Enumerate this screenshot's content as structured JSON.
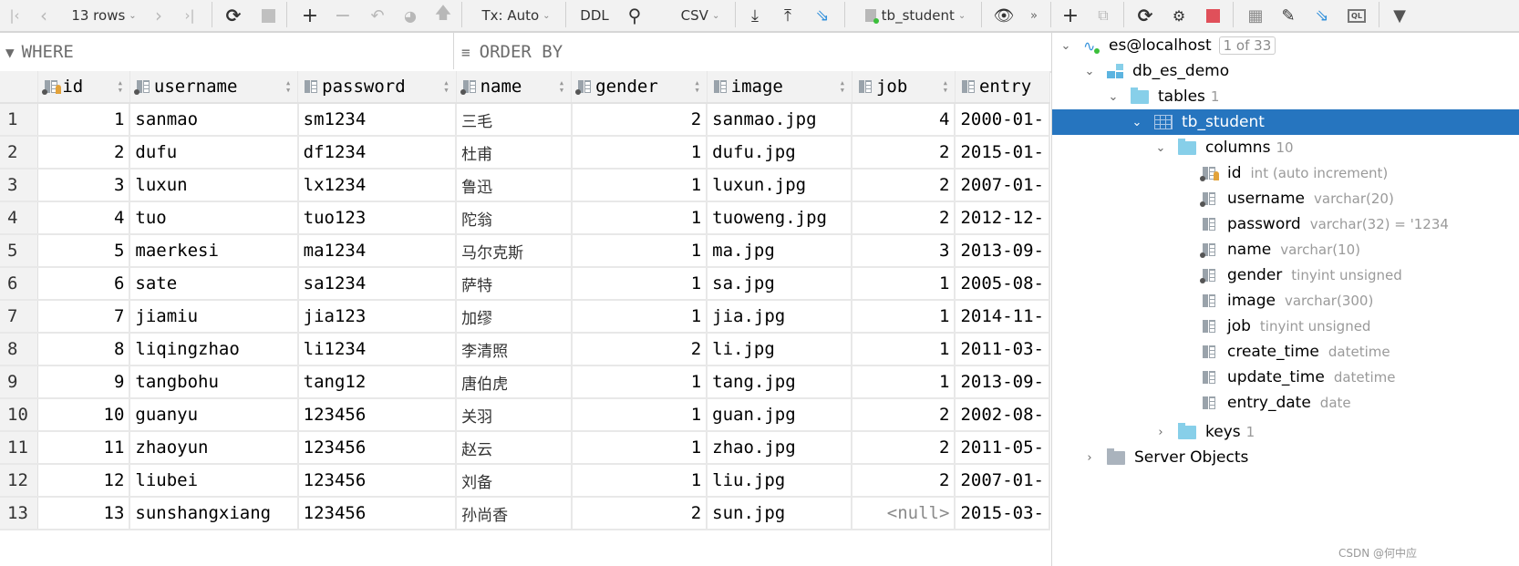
{
  "toolbar": {
    "rows_label": "13 rows",
    "tx_label": "Tx: Auto",
    "ddl_label": "DDL",
    "export_format": "CSV",
    "table_selector": "tb_student",
    "more_label": "»"
  },
  "filter": {
    "where_placeholder": "WHERE",
    "orderby_placeholder": "ORDER BY"
  },
  "grid": {
    "columns": [
      "id",
      "username",
      "password",
      "name",
      "gender",
      "image",
      "job",
      "entry"
    ],
    "rows": [
      {
        "n": "1",
        "id": "1",
        "username": "sanmao",
        "password": "sm1234",
        "name": "三毛",
        "gender": "2",
        "image": "sanmao.jpg",
        "job": "4",
        "entry": "2000-01-"
      },
      {
        "n": "2",
        "id": "2",
        "username": "dufu",
        "password": "df1234",
        "name": "杜甫",
        "gender": "1",
        "image": "dufu.jpg",
        "job": "2",
        "entry": "2015-01-"
      },
      {
        "n": "3",
        "id": "3",
        "username": "luxun",
        "password": "lx1234",
        "name": "鲁迅",
        "gender": "1",
        "image": "luxun.jpg",
        "job": "2",
        "entry": "2007-01-"
      },
      {
        "n": "4",
        "id": "4",
        "username": "tuo",
        "password": "tuo123",
        "name": "陀翁",
        "gender": "1",
        "image": "tuoweng.jpg",
        "job": "2",
        "entry": "2012-12-"
      },
      {
        "n": "5",
        "id": "5",
        "username": "maerkesi",
        "password": "ma1234",
        "name": "马尔克斯",
        "gender": "1",
        "image": "ma.jpg",
        "job": "3",
        "entry": "2013-09-"
      },
      {
        "n": "6",
        "id": "6",
        "username": "sate",
        "password": "sa1234",
        "name": "萨特",
        "gender": "1",
        "image": "sa.jpg",
        "job": "1",
        "entry": "2005-08-"
      },
      {
        "n": "7",
        "id": "7",
        "username": "jiamiu",
        "password": "jia123",
        "name": "加缪",
        "gender": "1",
        "image": "jia.jpg",
        "job": "1",
        "entry": "2014-11-"
      },
      {
        "n": "8",
        "id": "8",
        "username": "liqingzhao",
        "password": "li1234",
        "name": "李清照",
        "gender": "2",
        "image": "li.jpg",
        "job": "1",
        "entry": "2011-03-"
      },
      {
        "n": "9",
        "id": "9",
        "username": "tangbohu",
        "password": "tang12",
        "name": "唐伯虎",
        "gender": "1",
        "image": "tang.jpg",
        "job": "1",
        "entry": "2013-09-"
      },
      {
        "n": "10",
        "id": "10",
        "username": "guanyu",
        "password": "123456",
        "name": "关羽",
        "gender": "1",
        "image": "guan.jpg",
        "job": "2",
        "entry": "2002-08-"
      },
      {
        "n": "11",
        "id": "11",
        "username": "zhaoyun",
        "password": "123456",
        "name": "赵云",
        "gender": "1",
        "image": "zhao.jpg",
        "job": "2",
        "entry": "2011-05-"
      },
      {
        "n": "12",
        "id": "12",
        "username": "liubei",
        "password": "123456",
        "name": "刘备",
        "gender": "1",
        "image": "liu.jpg",
        "job": "2",
        "entry": "2007-01-"
      },
      {
        "n": "13",
        "id": "13",
        "username": "sunshangxiang",
        "password": "123456",
        "name": "孙尚香",
        "gender": "2",
        "image": "sun.jpg",
        "job": "<null>",
        "entry": "2015-03-"
      }
    ]
  },
  "tree": {
    "connection": "es@localhost",
    "connection_badge": "1 of 33",
    "schema": "db_es_demo",
    "tables_label": "tables",
    "tables_count": "1",
    "table": "tb_student",
    "columns_label": "columns",
    "columns_count": "10",
    "columns": [
      {
        "name": "id",
        "type": "int (auto increment)"
      },
      {
        "name": "username",
        "type": "varchar(20)"
      },
      {
        "name": "password",
        "type": "varchar(32) = '1234"
      },
      {
        "name": "name",
        "type": "varchar(10)"
      },
      {
        "name": "gender",
        "type": "tinyint unsigned"
      },
      {
        "name": "image",
        "type": "varchar(300)"
      },
      {
        "name": "job",
        "type": "tinyint unsigned"
      },
      {
        "name": "create_time",
        "type": "datetime"
      },
      {
        "name": "update_time",
        "type": "datetime"
      },
      {
        "name": "entry_date",
        "type": "date"
      }
    ],
    "keys_label": "keys",
    "keys_count": "1",
    "server_objects": "Server Objects"
  },
  "watermark": "CSDN @何中应",
  "colors": {
    "selection": "#2675bf",
    "folder": "#87cfe9",
    "stop": "#e0505a",
    "accent": "#3592db"
  }
}
